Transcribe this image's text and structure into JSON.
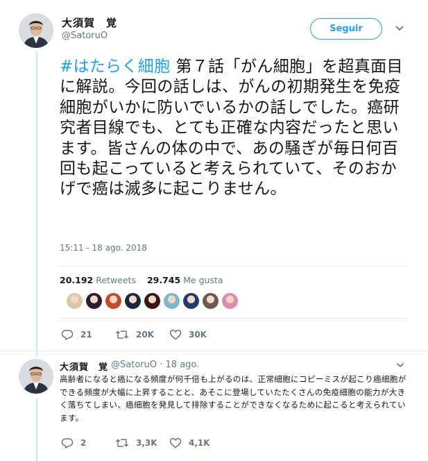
{
  "tweet": {
    "author_name": "大須賀　覚",
    "author_handle": "@SatoruO",
    "follow_label": "Seguir",
    "hashtag": "#はたらく細胞",
    "text": " 第７話「がん細胞」を超真面目に解説。今回の話しは、がんの初期発生を免疫細胞がいかに防いでいるかの話しでした。癌研究者目線でも、とても正確な内容だったと思います。皆さんの体の中で、あの騒ぎが毎日何百回も起こっていると考えられていて、そのおかげで癌は滅多に起こりません。",
    "timestamp": "15:11 - 18 ago. 2018",
    "retweets_count": "20.192",
    "retweets_label": "Retweets",
    "likes_count": "29.745",
    "likes_label": "Me gusta",
    "replies": "21",
    "retweets_short": "20K",
    "likes_short": "30K",
    "liker_colors": [
      "#d9c9a8",
      "#2a1d2e",
      "#c24a2e",
      "#1d2440",
      "#3a1416",
      "#7fb8c8",
      "#243a6a",
      "#6a5a50",
      "#e08ab0"
    ]
  },
  "reply": {
    "author_name": "大須賀　覚",
    "author_handle": "@SatoruO",
    "dot": "·",
    "date": "18 ago.",
    "text": "高齢者になると癌になる頻度が何千倍も上がるのは、正常細胞にコピーミスが起こり癌細胞ができる頻度が大幅に上昇することと、あそこに登場していたたくさんの免疫細胞の能力が大きく落ちてしまい、癌細胞を発見して排除することができなくなるために起こると考えられています。",
    "replies": "2",
    "retweets": "3,3K",
    "likes": "4,1K"
  },
  "colors": {
    "accent": "#1da1f2",
    "muted": "#657786",
    "thread": "#cce4f4"
  },
  "icons": [
    "reply-icon",
    "retweet-icon",
    "like-icon",
    "chevron-down-icon"
  ]
}
